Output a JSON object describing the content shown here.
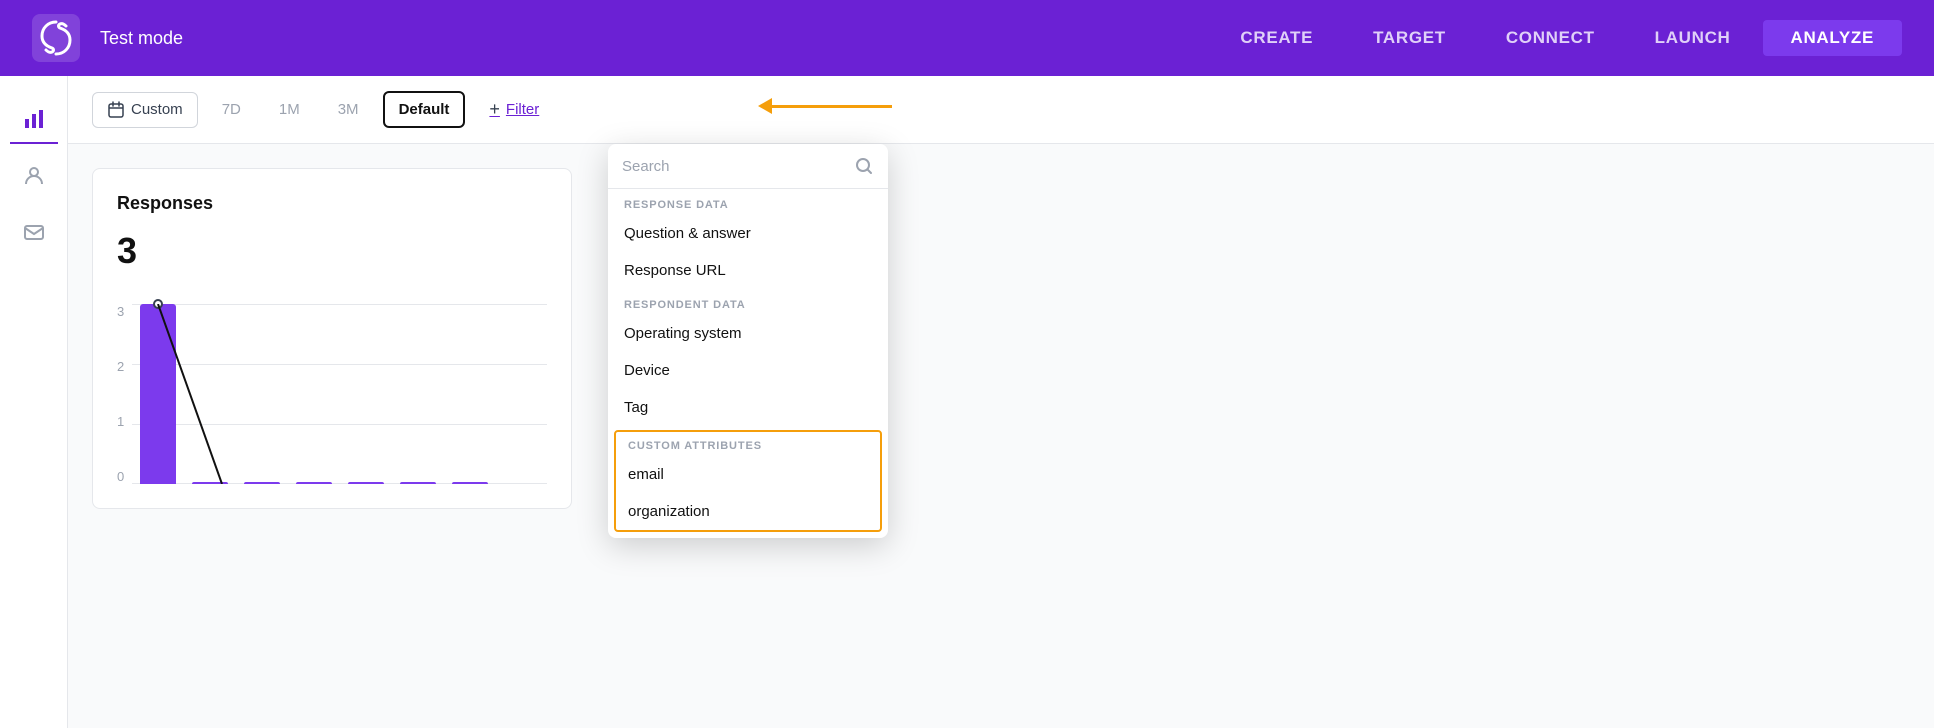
{
  "app": {
    "logo_alt": "App Logo",
    "test_mode_label": "Test mode"
  },
  "topnav": {
    "links": [
      {
        "id": "create",
        "label": "CREATE",
        "active": false
      },
      {
        "id": "target",
        "label": "TARGET",
        "active": false
      },
      {
        "id": "connect",
        "label": "CONNECT",
        "active": false
      },
      {
        "id": "launch",
        "label": "LAUNCH",
        "active": false
      },
      {
        "id": "analyze",
        "label": "ANALYZE",
        "active": true
      }
    ]
  },
  "toolbar": {
    "custom_label": "Custom",
    "period_7d": "7D",
    "period_1m": "1M",
    "period_3m": "3M",
    "period_default": "Default",
    "filter_label": "Filter",
    "plus_icon": "+"
  },
  "chart": {
    "title": "Responses",
    "total": "3",
    "y_labels": [
      "0",
      "1",
      "2",
      "3"
    ],
    "bar_height_max": 180,
    "bar_value": 3,
    "bar_max": 3
  },
  "dropdown": {
    "search_placeholder": "Search",
    "sections": [
      {
        "id": "response-data",
        "label": "RESPONSE DATA",
        "items": [
          {
            "id": "question-answer",
            "label": "Question & answer"
          },
          {
            "id": "response-url",
            "label": "Response URL"
          }
        ]
      },
      {
        "id": "respondent-data",
        "label": "RESPONDENT DATA",
        "items": [
          {
            "id": "operating-system",
            "label": "Operating system"
          },
          {
            "id": "device",
            "label": "Device"
          },
          {
            "id": "tag",
            "label": "Tag"
          }
        ]
      },
      {
        "id": "custom-attributes",
        "label": "CUSTOM ATTRIBUTES",
        "items": [
          {
            "id": "email",
            "label": "email"
          },
          {
            "id": "organization",
            "label": "organization"
          }
        ]
      }
    ]
  }
}
